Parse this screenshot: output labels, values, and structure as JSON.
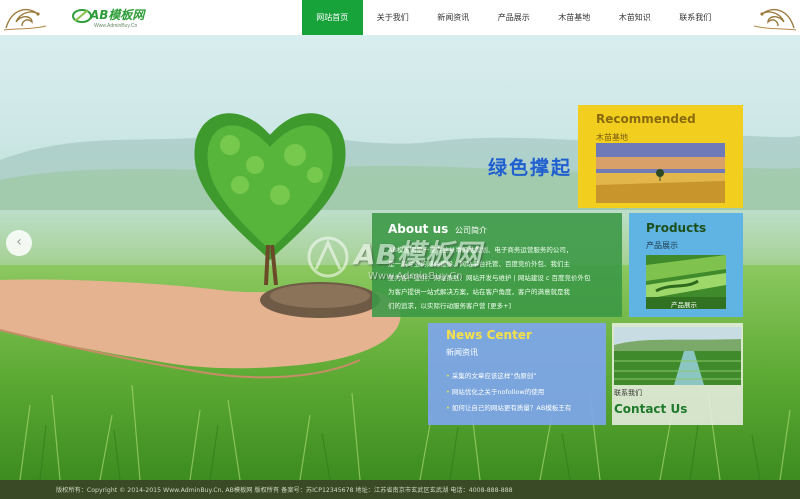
{
  "header": {
    "logo_text": "AB模板网",
    "logo_sub": "Www.AdminBuy.Cn",
    "nav": [
      {
        "label": "网站首页",
        "active": true
      },
      {
        "label": "关于我们"
      },
      {
        "label": "新闻资讯"
      },
      {
        "label": "产品展示"
      },
      {
        "label": "木苗基地"
      },
      {
        "label": "木苗知识"
      },
      {
        "label": "联系我们"
      }
    ]
  },
  "banner": {
    "slogan": "绿色撑起",
    "arrow": "‹",
    "watermark_text": "AB模板网",
    "watermark_url": "Www.AdminBuy.Cn"
  },
  "recommended": {
    "title": "Recommended",
    "subtitle": "木苗基地"
  },
  "about": {
    "title": "About us",
    "subtitle": "公司简介",
    "lines": [
      "AB模板网是一家专业从事网站策划、电子商务运营服务的公司，",
      "是一家专业的网站建设、网站平台托管、百度竞价外包、我们主",
      "要为客户提供：网站策划、网站开发与维护 | 网站建设 c 百度竞价外包",
      "为客户提供一站式解决方案，站在客户角度，客户的满意就是我",
      "们的追求，以实际行动服务客户营"
    ],
    "more": "[更多+]"
  },
  "products": {
    "title": "Products",
    "subtitle": "产品展示",
    "caption": "产品展示"
  },
  "news": {
    "title": "News Center",
    "subtitle": "新闻资讯",
    "items": [
      "采集的文章应该这样“伪原创”",
      "网站优化之关于nofollow的使用",
      "如何让自己的网站更有质量？AB模板王有"
    ]
  },
  "contact": {
    "subtitle": "联系我们",
    "title": "Contact Us"
  },
  "footer": {
    "text": "版权所有：Copyright © 2014-2015 Www.AdminBuy.Cn, AB模板网 版权所有    备案号：苏ICP12345678    地址：江苏省南京市玄武区玄武湖    电话：4008-888-888"
  },
  "colors": {
    "nav_active": "#17a23a",
    "recommended_bg": "#f2cf1e",
    "about_bg": "#3a9746",
    "products_bg": "#5fb4e3",
    "news_bg": "#7ea5ec",
    "footer_bg": "#3b4a26"
  },
  "icons": [
    "left-ornament-icon",
    "right-ornament-icon",
    "prev-slide-icon",
    "logo-icon"
  ]
}
